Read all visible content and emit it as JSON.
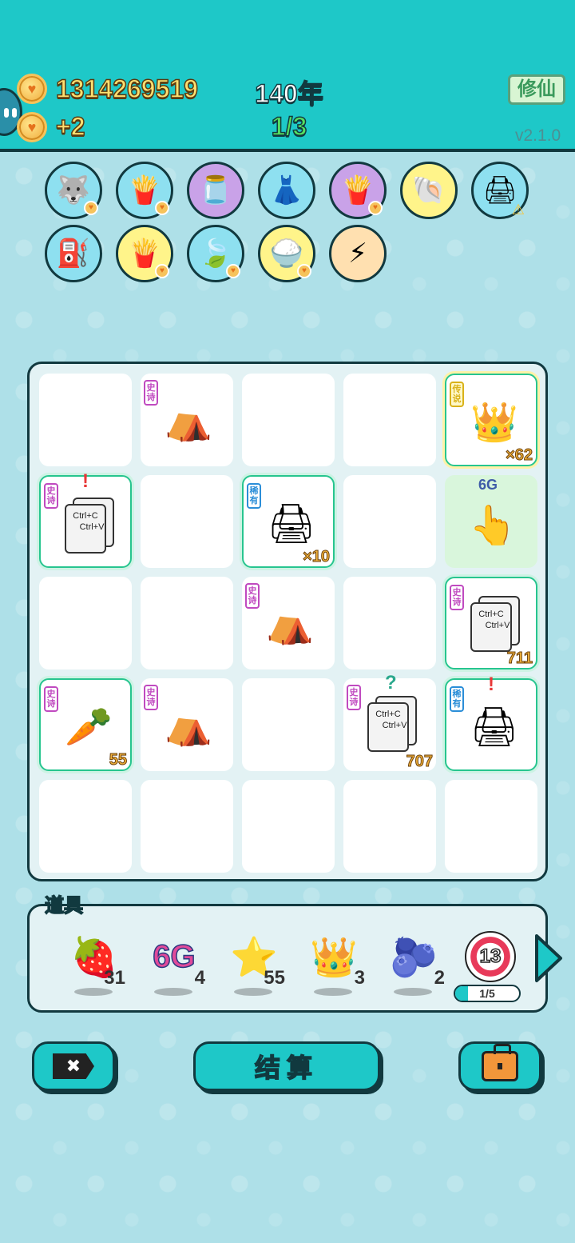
{
  "hud": {
    "gold": "1314269519",
    "income": "+2",
    "year": "140年",
    "progress": "1/3",
    "mode_button": "修仙",
    "version": "v2.1.0"
  },
  "relics": [
    {
      "name": "husky-icon",
      "bg": "blue"
    },
    {
      "name": "fries-icon",
      "bg": "blue"
    },
    {
      "name": "jar-icon",
      "bg": "purple"
    },
    {
      "name": "skirt-icon",
      "bg": "blue"
    },
    {
      "name": "fries-icon",
      "bg": "purple"
    },
    {
      "name": "shell-icon",
      "bg": "yellow"
    },
    {
      "name": "printer-icon",
      "bg": "blue"
    },
    {
      "name": "pump-icon",
      "bg": "blue"
    },
    {
      "name": "fries-icon",
      "bg": "yellow"
    },
    {
      "name": "leaf-icon",
      "bg": "blue"
    },
    {
      "name": "rice-bowl-icon",
      "bg": "yellow"
    },
    {
      "name": "lightning-icon",
      "bg": "peach"
    }
  ],
  "board": {
    "tags": {
      "epic": "史诗",
      "rare": "稀有",
      "legendary": "传说"
    },
    "counts": {
      "king": "×62",
      "printer": "×10",
      "copy1": "711",
      "carrot": "55",
      "copy2": "707"
    },
    "six_g": "6G",
    "copy_text1": "Ctrl+C",
    "copy_text2": "Ctrl+V",
    "exclaim": "!",
    "question": "?"
  },
  "props": {
    "title": "道具",
    "items": [
      {
        "name": "lychee",
        "count": "31"
      },
      {
        "name": "6g",
        "label": "6G",
        "count": "4"
      },
      {
        "name": "star",
        "count": "55"
      },
      {
        "name": "crown",
        "count": "3"
      },
      {
        "name": "blueberry",
        "count": "2"
      },
      {
        "name": "target",
        "label": "13"
      }
    ],
    "target_progress": "1/5",
    "target_progress_fraction": 0.2
  },
  "buttons": {
    "close": "✖",
    "settle": "结算"
  }
}
